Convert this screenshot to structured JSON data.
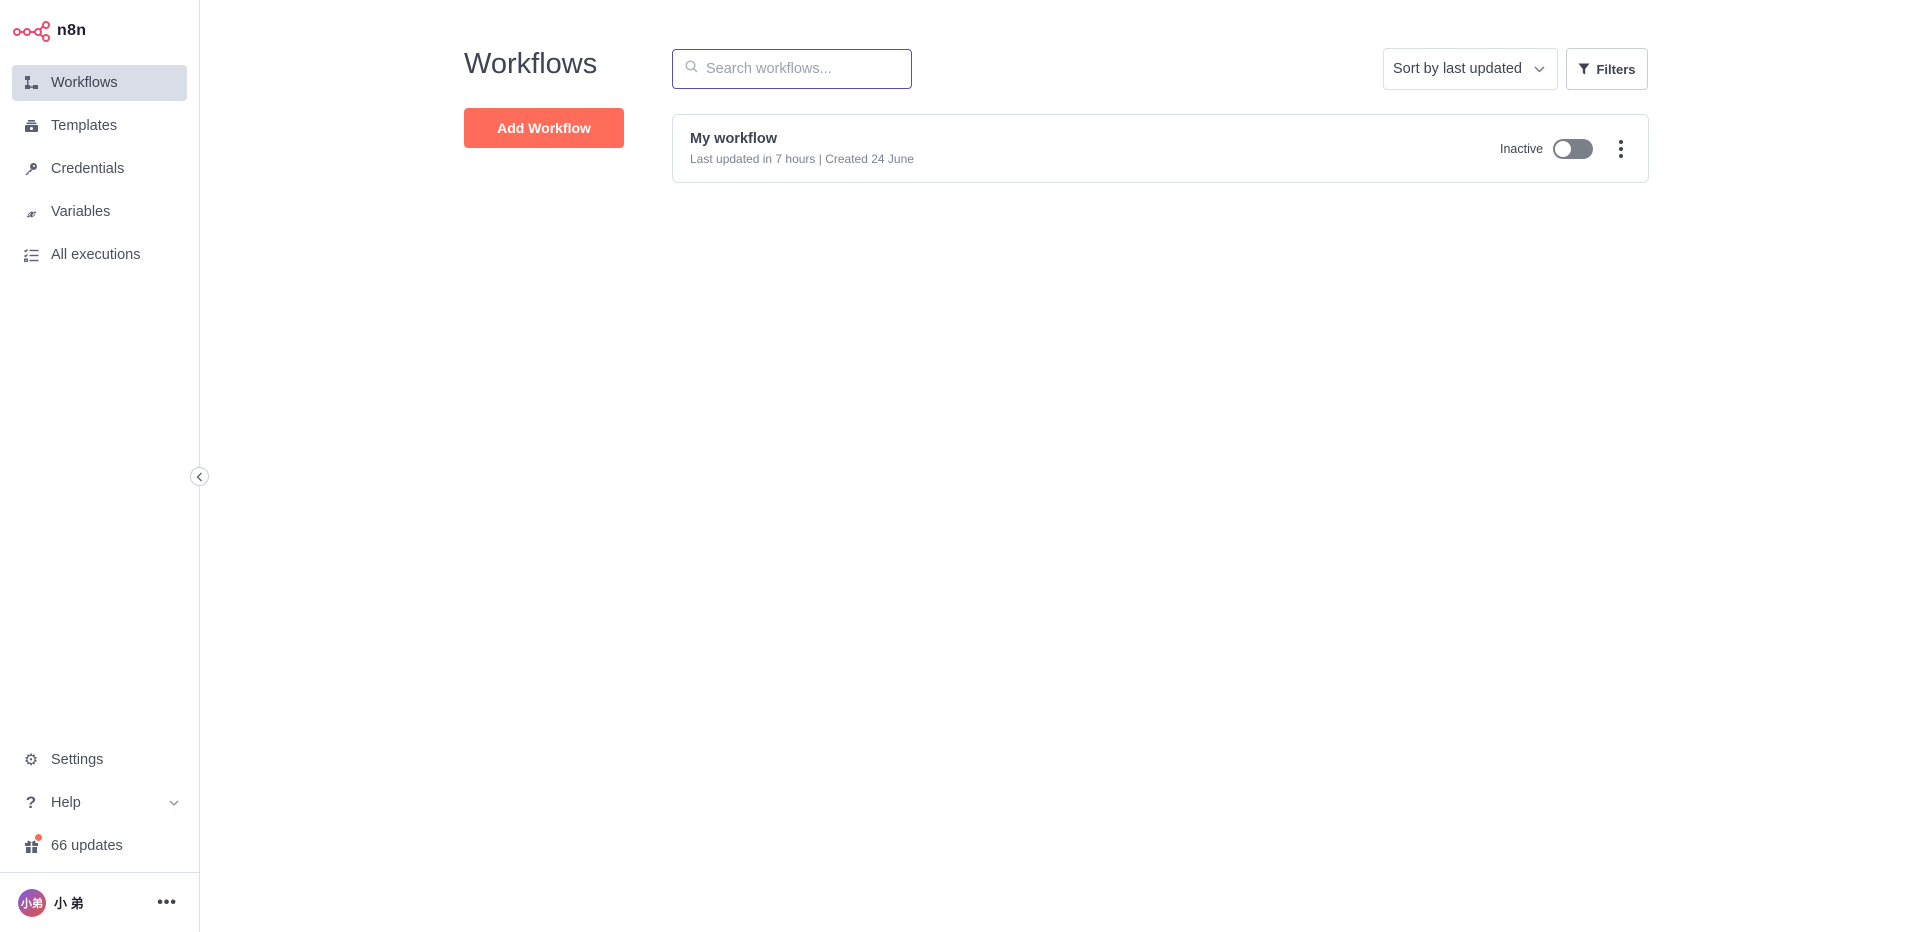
{
  "app": {
    "name": "n8n"
  },
  "sidebar": {
    "items": [
      {
        "label": "Workflows",
        "icon": "workflows-icon",
        "active": true
      },
      {
        "label": "Templates",
        "icon": "templates-icon",
        "active": false
      },
      {
        "label": "Credentials",
        "icon": "key-icon",
        "active": false
      },
      {
        "label": "Variables",
        "icon": "variable-icon",
        "active": false
      },
      {
        "label": "All executions",
        "icon": "list-check-icon",
        "active": false
      }
    ],
    "bottom": {
      "settings": "Settings",
      "help": "Help",
      "updates": "66 updates"
    },
    "user": {
      "initials": "小弟",
      "name": "小 弟"
    }
  },
  "main": {
    "title": "Workflows",
    "add_button": "Add Workflow",
    "search": {
      "placeholder": "Search workflows...",
      "value": ""
    },
    "sort": {
      "selected": "Sort by last updated"
    },
    "filters_label": "Filters",
    "workflows": [
      {
        "name": "My workflow",
        "meta": "Last updated in 7 hours | Created 24 June",
        "status": "Inactive",
        "active": false
      }
    ]
  },
  "colors": {
    "accent": "#ff6d5a",
    "active_nav_bg": "#d8dde7",
    "search_border": "#5a4fb0"
  }
}
